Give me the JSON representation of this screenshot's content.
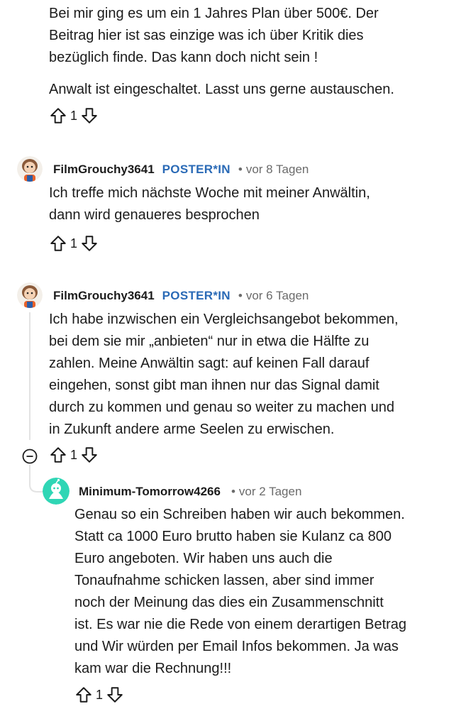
{
  "comment_top": {
    "paragraphs": [
      "Bei mir ging es um ein 1 Jahres Plan über 500€. Der\nBeitrag hier ist sas einzige was ich über Kritik dies\nbezüglich finde. Das kann doch nicht sein !",
      "Anwalt ist eingeschaltet. Lasst uns gerne austauschen."
    ],
    "votes": "1"
  },
  "comment_2": {
    "author": "FilmGrouchy3641",
    "badge": "POSTER*IN",
    "separator": "•",
    "time": "vor 8 Tagen",
    "body": "Ich treffe mich nächste Woche mit meiner Anwältin,\ndann wird genaueres besprochen",
    "votes": "1"
  },
  "comment_3": {
    "author": "FilmGrouchy3641",
    "badge": "POSTER*IN",
    "separator": "•",
    "time": "vor 6 Tagen",
    "body": "Ich habe inzwischen ein Vergleichsangebot bekommen,\nbei dem sie mir „anbieten“ nur in etwa die Hälfte zu\nzahlen. Meine Anwältin sagt: auf keinen Fall darauf\neingehen, sonst gibt man ihnen nur das Signal damit\ndurch zu kommen und genau so weiter zu machen und\nin Zukunft andere arme Seelen zu erwischen.",
    "votes": "1"
  },
  "comment_4": {
    "author": "Minimum-Tomorrow4266",
    "separator": "•",
    "time": "vor 2 Tagen",
    "body": "Genau so ein Schreiben haben wir auch bekommen.\nStatt ca 1000 Euro brutto haben sie Kulanz ca 800\nEuro angeboten. Wir haben uns auch die\nTonaufnahme schicken lassen, aber sind immer\nnoch der Meinung das dies ein Zusammenschnitt\nist. Es war nie die Rede von einem derartigen Betrag\nund Wir würden per Email Infos bekommen. Ja was\nkam war die Rechnung!!!",
    "votes": "1"
  },
  "colors": {
    "badge": "#2a6ab6",
    "meta": "#6b6b6b",
    "avatar_green": "#2fd6b5"
  }
}
